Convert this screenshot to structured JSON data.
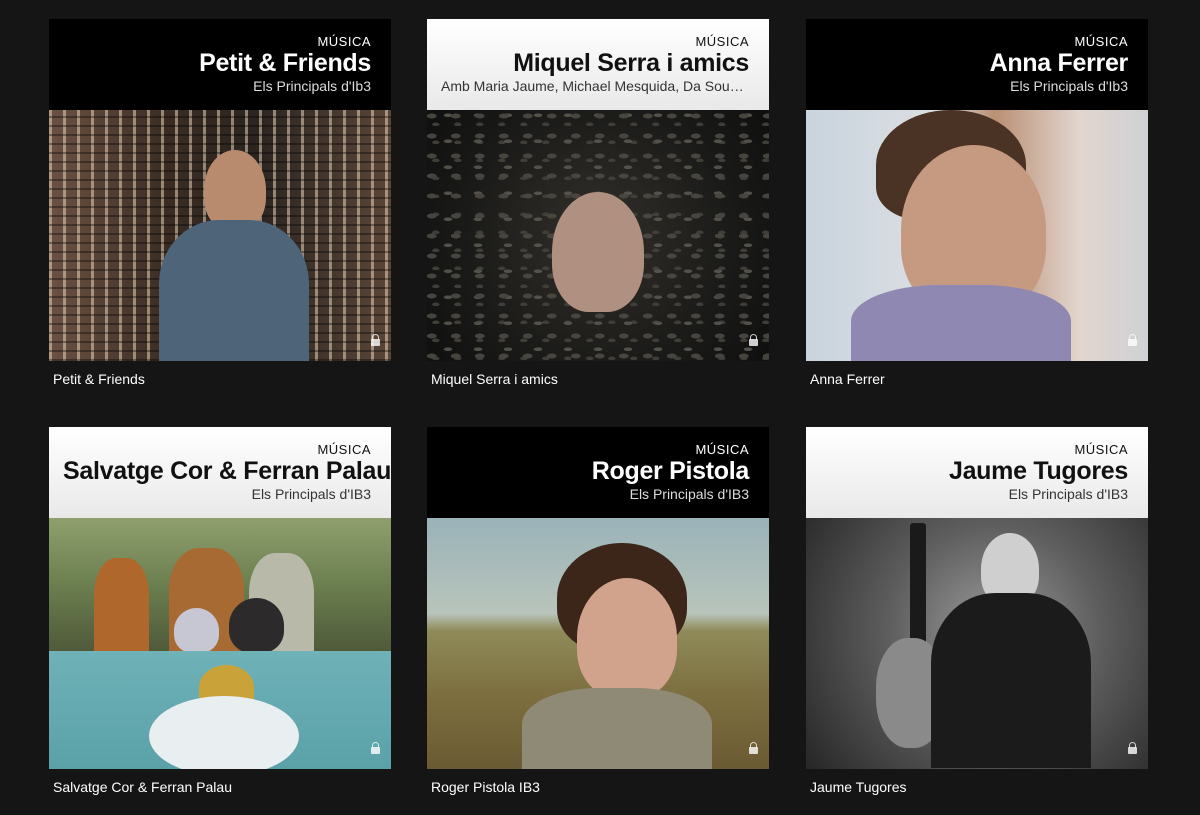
{
  "cards": [
    {
      "category": "MÚSICA",
      "title": "Petit & Friends",
      "subtitle": "Els Principals d'Ib3",
      "caption": "Petit & Friends",
      "header_theme": "dark"
    },
    {
      "category": "MÚSICA",
      "title": "Miquel Serra i amics",
      "subtitle": "Amb Maria Jaume, Michael Mesquida, Da Souza...",
      "caption": "Miquel Serra i amics",
      "header_theme": "light"
    },
    {
      "category": "MÚSICA",
      "title": "Anna Ferrer",
      "subtitle": "Els Principals d'Ib3",
      "caption": "Anna Ferrer",
      "header_theme": "dark"
    },
    {
      "category": "MÚSICA",
      "title": "Salvatge Cor & Ferran Palau",
      "subtitle": "Els Principals d'IB3",
      "caption": "Salvatge Cor & Ferran Palau",
      "header_theme": "light"
    },
    {
      "category": "MÚSICA",
      "title": "Roger Pistola",
      "subtitle": "Els Principals d'IB3",
      "caption": "Roger Pistola IB3",
      "header_theme": "dark"
    },
    {
      "category": "MÚSICA",
      "title": "Jaume Tugores",
      "subtitle": "Els Principals d'IB3",
      "caption": "Jaume Tugores",
      "header_theme": "light"
    }
  ],
  "icons": {
    "lock": "lock-icon"
  },
  "colors": {
    "background": "#151515",
    "header_dark": "#000000",
    "header_light": "#ffffff",
    "caption_text": "#ffffff"
  }
}
